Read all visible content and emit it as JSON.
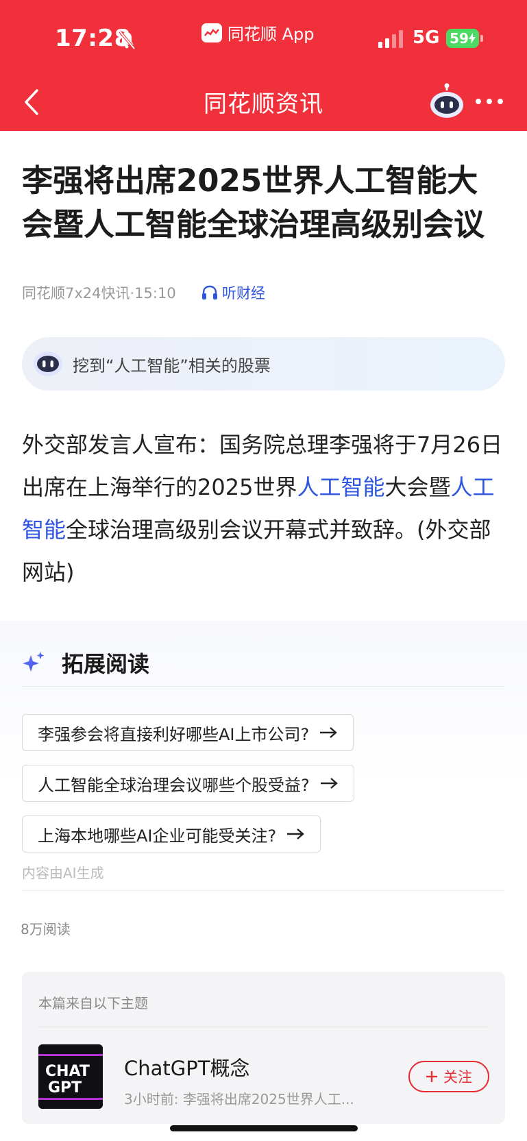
{
  "status_bar": {
    "time": "17:28",
    "app_name": "同花顺 App",
    "network": "5G",
    "battery": "59"
  },
  "nav": {
    "title": "同花顺资讯",
    "icons": [
      "back-chevron-icon",
      "robot-assistant-icon",
      "more-dots-icon"
    ]
  },
  "article": {
    "title": "李强将出席2025世界人工智能大会暨人工智能全球治理高级别会议",
    "source_time": "同花顺7x24快讯·15:10",
    "listen_label": "听财经",
    "ai_prompt": "挖到“人工智能”相关的股票",
    "content": {
      "part1": "外交部发言人宣布：国务院总理李强将于7月26日出席在上海举行的2025世界",
      "link1": "人工智能",
      "part2": "大会暨",
      "link2": "人工智能",
      "part3": "全球治理高级别会议开幕式并致辞。(外交部网站)"
    }
  },
  "extended_reading": {
    "title": "拓展阅读",
    "questions": [
      "李强参会将直接利好哪些AI上市公司?",
      "人工智能全球治理会议哪些个股受益?",
      "上海本地哪些AI企业可能受关注?"
    ],
    "ai_generated_note": "内容由AI生成"
  },
  "read_count": "8万阅读",
  "topic": {
    "header": "本篇来自以下主题",
    "logo_text_line1": "CHAT",
    "logo_text_line2": "GPT",
    "name": "ChatGPT概念",
    "subtitle": "3小时前: 李强将出席2025世界人工...",
    "follow_label": "关注"
  },
  "colors": {
    "brand_red": "#f0313b",
    "link_blue": "#2f56e0",
    "battery_green": "#4cd964"
  }
}
